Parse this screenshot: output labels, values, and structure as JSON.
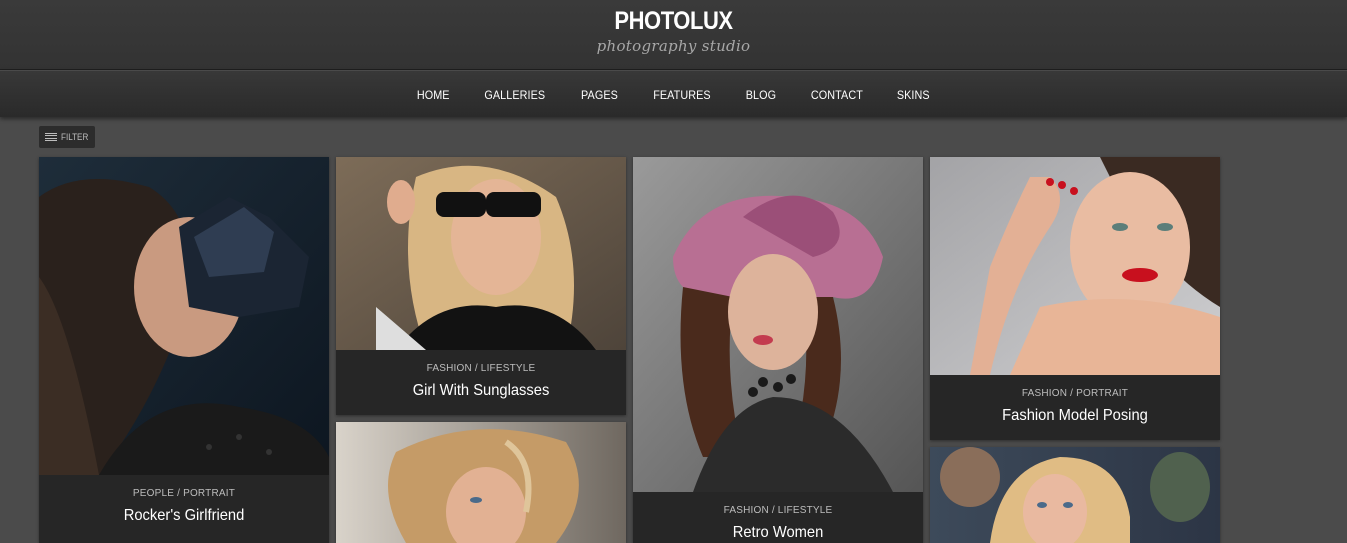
{
  "header": {
    "logo_title": "PHOTOLUX",
    "logo_subtitle": "photography studio"
  },
  "nav": {
    "items": [
      "HOME",
      "GALLERIES",
      "PAGES",
      "FEATURES",
      "BLOG",
      "CONTACT",
      "SKINS"
    ]
  },
  "filter": {
    "icon": "menu-lines-icon",
    "label": "FILTER"
  },
  "gallery": {
    "items": [
      {
        "category": "PEOPLE / PORTRAIT",
        "title": "Rocker's Girlfriend"
      },
      {
        "category": "FASHION / LIFESTYLE",
        "title": "Girl With Sunglasses"
      },
      {
        "category": "FASHION / LIFESTYLE",
        "title": "Retro Women"
      },
      {
        "category": "FASHION / PORTRAIT",
        "title": "Fashion Model Posing"
      },
      {
        "category": "",
        "title": ""
      },
      {
        "category": "",
        "title": ""
      }
    ]
  },
  "colors": {
    "page_background": "#4b4b4b",
    "header_background": "#353535",
    "caption_background": "#262626",
    "accent_text": "#ffffff"
  }
}
